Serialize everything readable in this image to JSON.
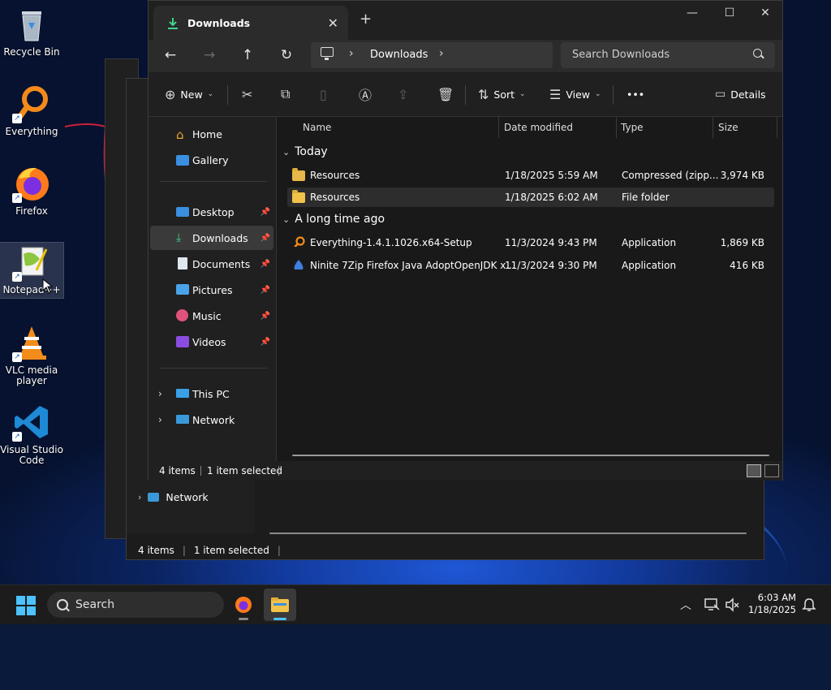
{
  "desktop": {
    "icons": [
      {
        "label": "Recycle Bin"
      },
      {
        "label": "Everything"
      },
      {
        "label": "Firefox"
      },
      {
        "label": "Notepad++"
      },
      {
        "label": "VLC media player"
      },
      {
        "label": "Visual Studio Code"
      }
    ]
  },
  "background_window": {
    "nav_network": "Network",
    "status_count": "4 items",
    "status_selected": "1 item selected"
  },
  "window": {
    "tab_title": "Downloads",
    "address": {
      "crumb": "Downloads",
      "search_placeholder": "Search Downloads"
    },
    "commands": {
      "new": "New",
      "sort": "Sort",
      "view": "View",
      "more": "•••",
      "details": "Details"
    },
    "nav": {
      "home": "Home",
      "gallery": "Gallery",
      "desktop": "Desktop",
      "downloads": "Downloads",
      "documents": "Documents",
      "pictures": "Pictures",
      "music": "Music",
      "videos": "Videos",
      "this_pc": "This PC",
      "network": "Network"
    },
    "columns": {
      "name": "Name",
      "date": "Date modified",
      "type": "Type",
      "size": "Size"
    },
    "groups": {
      "today": "Today",
      "long_ago": "A long time ago"
    },
    "files": [
      {
        "name": "Resources",
        "date": "1/18/2025 5:59 AM",
        "type": "Compressed (zipp...",
        "size": "3,974 KB"
      },
      {
        "name": "Resources",
        "date": "1/18/2025 6:02 AM",
        "type": "File folder",
        "size": ""
      },
      {
        "name": "Everything-1.4.1.1026.x64-Setup",
        "date": "11/3/2024 9:43 PM",
        "type": "Application",
        "size": "1,869 KB"
      },
      {
        "name": "Ninite 7Zip Firefox Java AdoptOpenJDK x...",
        "date": "11/3/2024 9:30 PM",
        "type": "Application",
        "size": "416 KB"
      }
    ],
    "status": {
      "count": "4 items",
      "selected": "1 item selected"
    }
  },
  "taskbar": {
    "search_label": "Search",
    "time": "6:03 AM",
    "date": "1/18/2025"
  },
  "colors": {
    "accent": "#4cc2ff",
    "window_bg": "#191919",
    "folder": "#f2c34a"
  }
}
